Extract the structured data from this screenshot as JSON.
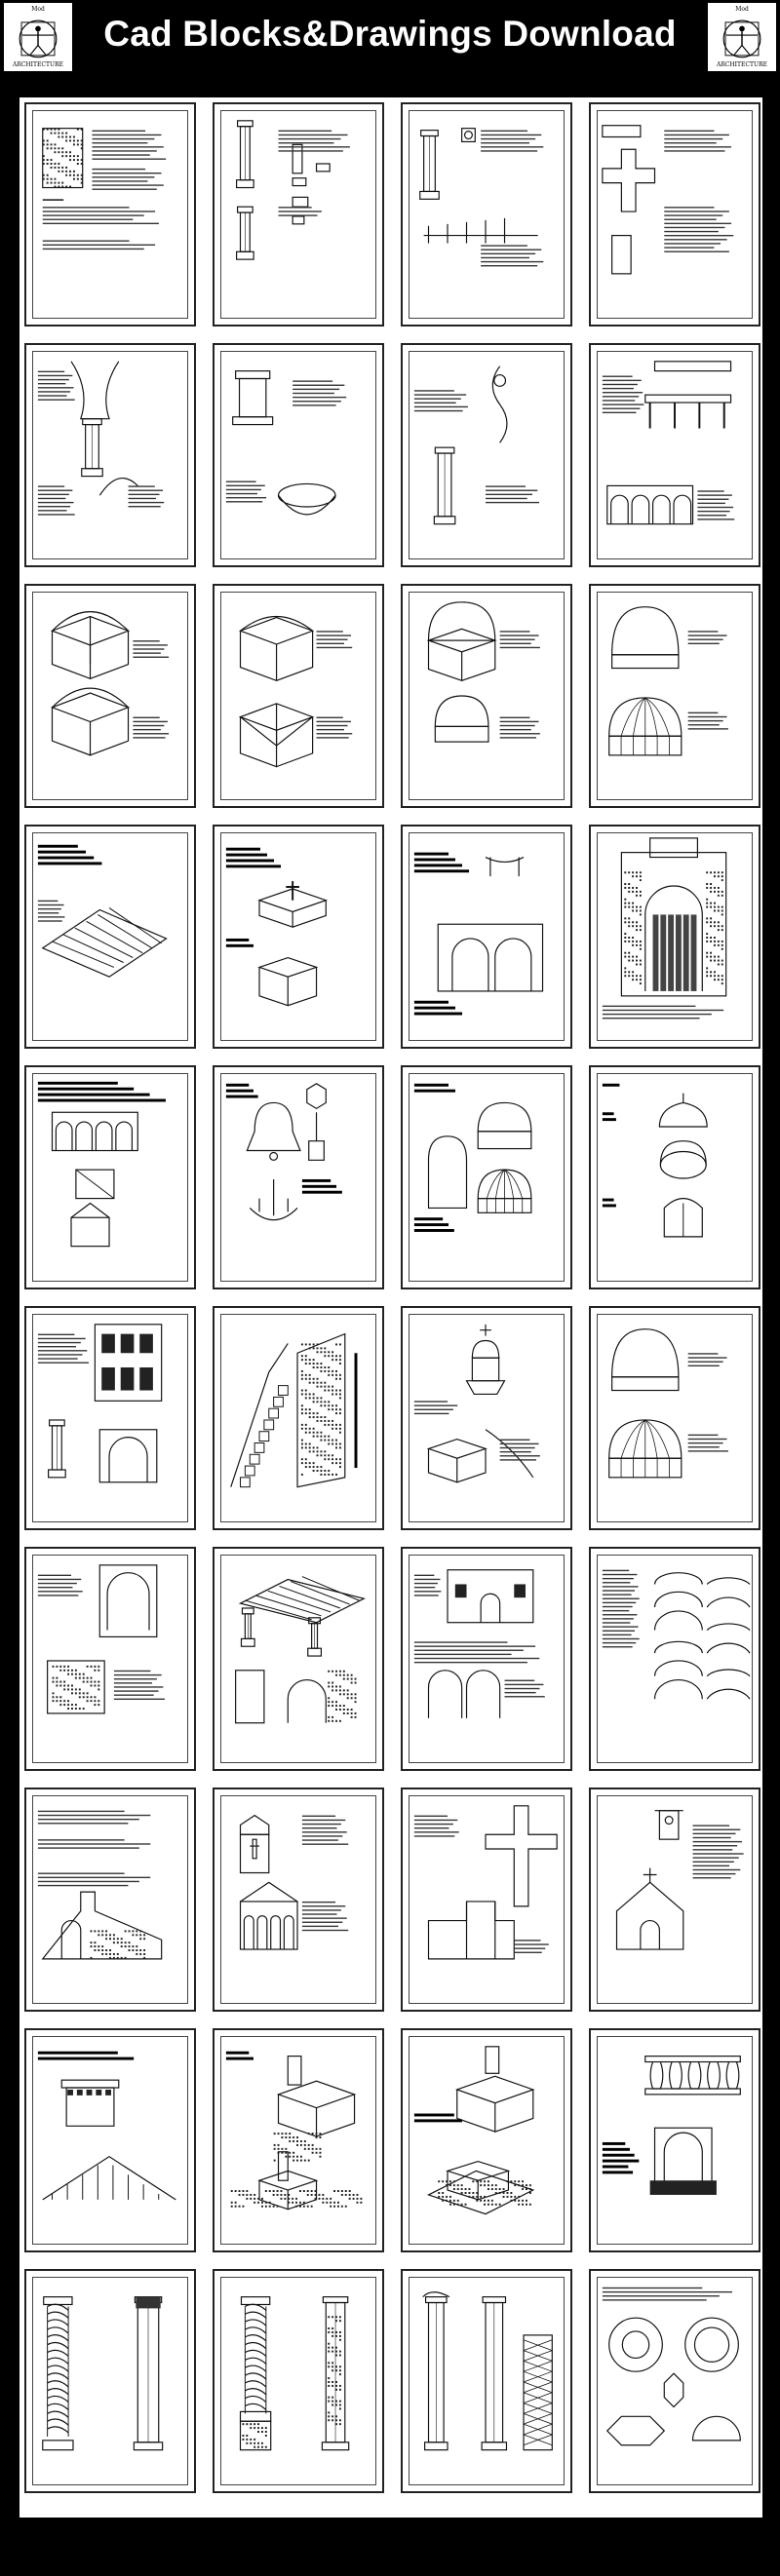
{
  "header": {
    "title": "Cad Blocks&Drawings Download",
    "logo_top_text": "Mod",
    "logo_bottom_text": "ARCHITECTURE"
  },
  "colors": {
    "background": "#000000",
    "sheet": "#ffffff",
    "line": "#111111"
  },
  "grid": {
    "rows": 10,
    "columns": 4
  },
  "sheets": [
    {
      "kind": "tower"
    },
    {
      "kind": "column-details"
    },
    {
      "kind": "column-base"
    },
    {
      "kind": "cross-plan"
    },
    {
      "kind": "capital-column"
    },
    {
      "kind": "pedestal-basin"
    },
    {
      "kind": "finial-column"
    },
    {
      "kind": "balustrade-arcade"
    },
    {
      "kind": "groin-vault"
    },
    {
      "kind": "cube-vaults"
    },
    {
      "kind": "dome-cube"
    },
    {
      "kind": "domes-pair"
    },
    {
      "kind": "roof-truss"
    },
    {
      "kind": "tomb-blocks"
    },
    {
      "kind": "arch-niche"
    },
    {
      "kind": "portal-facade"
    },
    {
      "kind": "arcade-chapel"
    },
    {
      "kind": "bell-chandelier"
    },
    {
      "kind": "dome-fountain"
    },
    {
      "kind": "lanterns"
    },
    {
      "kind": "facade-elevation"
    },
    {
      "kind": "stair-section"
    },
    {
      "kind": "cupola-block"
    },
    {
      "kind": "domes-pair"
    },
    {
      "kind": "house-window"
    },
    {
      "kind": "pergola-block"
    },
    {
      "kind": "mission-facade"
    },
    {
      "kind": "arch-types"
    },
    {
      "kind": "city-gate"
    },
    {
      "kind": "church-section"
    },
    {
      "kind": "cross-plan2"
    },
    {
      "kind": "chapel-elevation"
    },
    {
      "kind": "cornice-pavilion"
    },
    {
      "kind": "church-iso"
    },
    {
      "kind": "church-iso2"
    },
    {
      "kind": "balcony"
    },
    {
      "kind": "spiral-column"
    },
    {
      "kind": "twisted-column"
    },
    {
      "kind": "pilaster-column"
    },
    {
      "kind": "rosettes"
    }
  ]
}
